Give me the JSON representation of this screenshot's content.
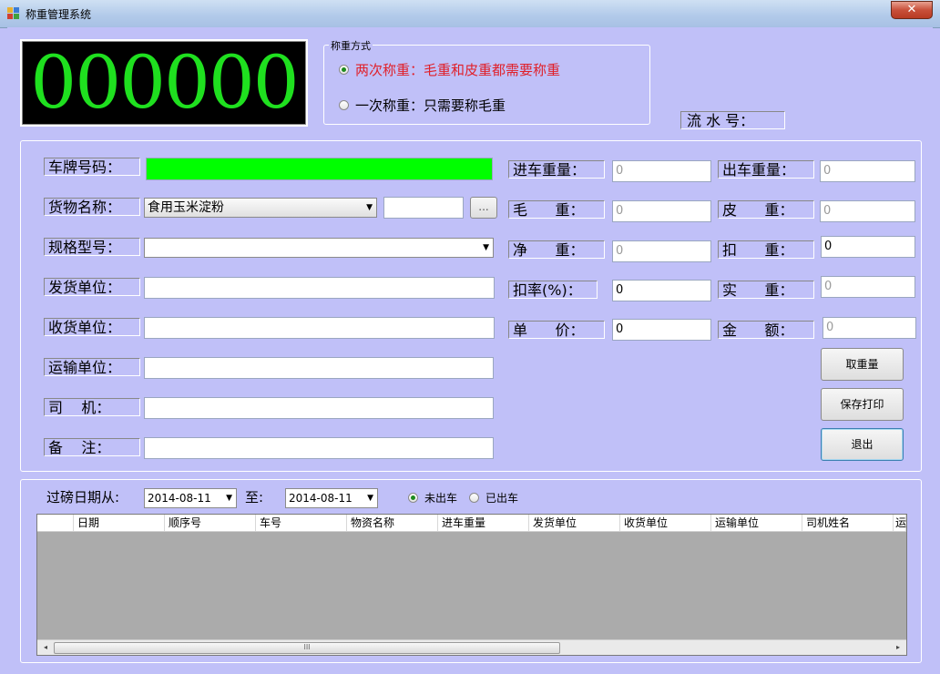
{
  "window": {
    "title": "称重管理系统",
    "close_label": "✕"
  },
  "display": {
    "weight": "000000"
  },
  "weigh_mode": {
    "legend": "称重方式",
    "options": [
      {
        "label": "两次称重：毛重和皮重都需要称重",
        "checked": true,
        "color": "#e0202a"
      },
      {
        "label": "一次称重：只需要称毛重",
        "checked": false,
        "color": "#000000"
      }
    ]
  },
  "serial": {
    "label": "流 水 号：",
    "value": ""
  },
  "form": {
    "plate": {
      "label": "车牌号码：",
      "value": "",
      "color": "#00ff00"
    },
    "goods": {
      "label": "货物名称：",
      "value": "食用玉米淀粉",
      "extra": "",
      "browse_label": "..."
    },
    "spec": {
      "label": "规格型号：",
      "value": ""
    },
    "sender": {
      "label": "发货单位：",
      "value": ""
    },
    "receiver": {
      "label": "收货单位：",
      "value": ""
    },
    "carrier": {
      "label": "运输单位：",
      "value": ""
    },
    "driver": {
      "label": "司    机：",
      "value": ""
    },
    "note": {
      "label": "备    注：",
      "value": ""
    }
  },
  "weights": {
    "in_weight": {
      "label": "进车重量：",
      "value": "0"
    },
    "out_weight": {
      "label": "出车重量：",
      "value": "0"
    },
    "gross": {
      "label": "毛      重：",
      "value": "0"
    },
    "tare": {
      "label": "皮      重：",
      "value": "0"
    },
    "net": {
      "label": "净      重：",
      "value": "0"
    },
    "deduct": {
      "label": "扣      重：",
      "value": "0"
    },
    "deduct_rate": {
      "label": "扣率(%)：",
      "value": "0"
    },
    "actual": {
      "label": "实      重：",
      "value": "0"
    },
    "unit_price": {
      "label": "单      价：",
      "value": "0"
    },
    "amount": {
      "label": "金      额：",
      "value": "0"
    }
  },
  "buttons": {
    "get_weight": "取重量",
    "save_print": "保存打印",
    "exit": "退出"
  },
  "filter": {
    "date_label": "过磅日期从:",
    "from_date": "2014-08-11",
    "to_label": "至:",
    "to_date": "2014-08-11",
    "status_options": [
      {
        "label": "未出车",
        "checked": true
      },
      {
        "label": "已出车",
        "checked": false
      }
    ]
  },
  "table": {
    "columns": [
      "日期",
      "顺序号",
      "车号",
      "物资名称",
      "进车重量",
      "发货单位",
      "收货单位",
      "运输单位",
      "司机姓名",
      "运"
    ],
    "rows": []
  },
  "scrollbar": {
    "thumb_glyph": "III",
    "left_arrow": "◂",
    "right_arrow": "▸"
  }
}
